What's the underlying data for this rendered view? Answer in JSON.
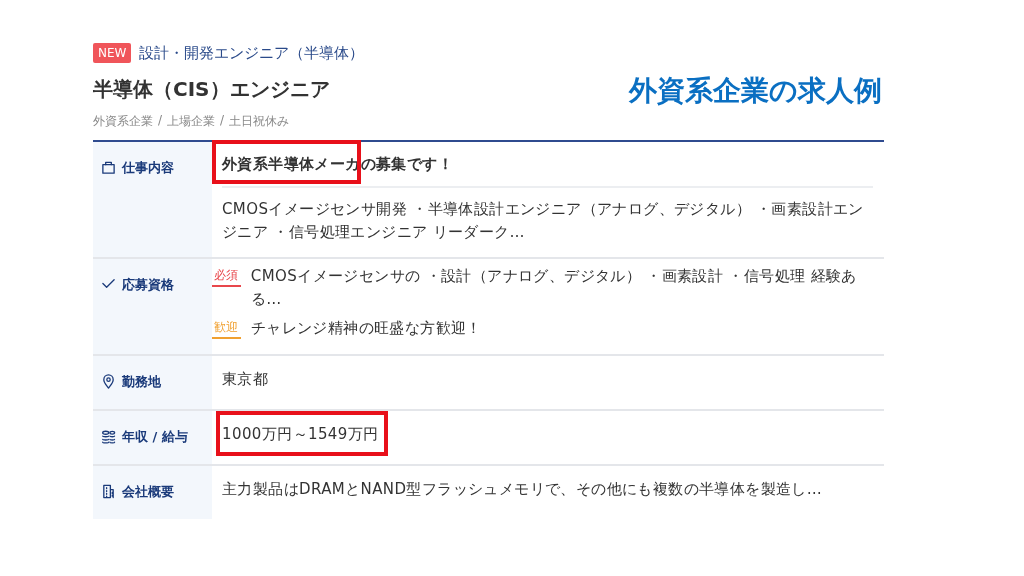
{
  "header": {
    "badge": "NEW",
    "category": "設計・開発エンジニア（半導体）",
    "title": "半導体（CIS）エンジニア",
    "tags": [
      "外資系企業",
      "上場企業",
      "土日祝休み"
    ],
    "tag_separator": "/"
  },
  "caption": "外資系企業の求人例",
  "rows": [
    {
      "kind": "description",
      "label": "仕事内容",
      "headline": "外資系半導体メーカの募集です！",
      "headline_highlighted": true,
      "text": "CMOSイメージセンサ開発 ・半導体設計エンジニア（アナログ、デジタル） ・画素設計エンジニア ・信号処理エンジニア リーダーク…"
    },
    {
      "kind": "requirements",
      "label": "応募資格",
      "items": [
        {
          "tag": "必須",
          "color": "#e8474c",
          "text": "CMOSイメージセンサの ・設計（アナログ、デジタル） ・画素設計 ・信号処理 経験ある…"
        },
        {
          "tag": "歓迎",
          "color": "#f0a030",
          "text": "チャレンジ精神の旺盛な方歓迎！"
        }
      ]
    },
    {
      "kind": "plain",
      "label": "勤務地",
      "text": "東京都",
      "highlighted": false
    },
    {
      "kind": "plain",
      "label": "年収 / 給与",
      "text": "1000万円～1549万円",
      "highlighted": true
    },
    {
      "kind": "plain",
      "label": "会社概要",
      "text": "主力製品はDRAMとNAND型フラッシュメモリで、その他にも複数の半導体を製造し…",
      "highlighted": false
    }
  ]
}
